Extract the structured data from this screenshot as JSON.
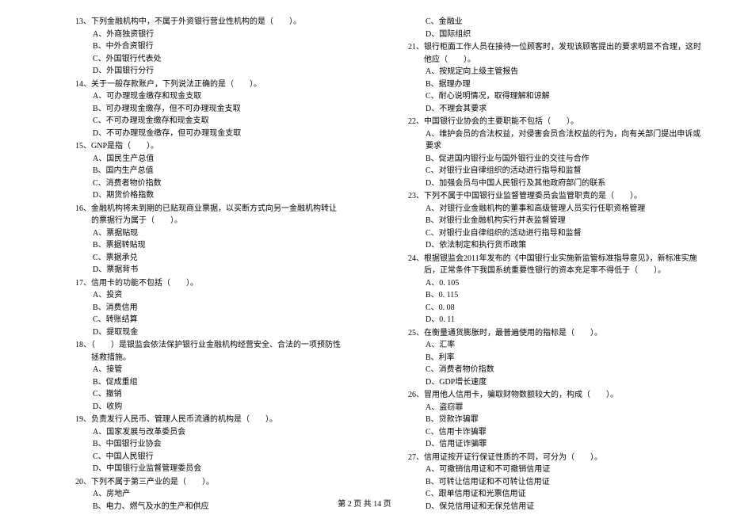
{
  "footer": "第 2 页  共 14 页",
  "left": {
    "q13": {
      "title": "13、下列金融机构中，不属于外资银行营业性机构的是（　　）。",
      "a": "A、外商独资银行",
      "b": "B、中外合资银行",
      "c": "C、外国银行代表处",
      "d": "D、外国银行分行"
    },
    "q14": {
      "title": "14、关于一般存款账户，下列说法正确的是（　　）。",
      "a": "A、可办理现金缴存和现金支取",
      "b": "B、可办理现金缴存，但不可办理现金支取",
      "c": "C、不可办理现金缴存和现金支取",
      "d": "D、不可办理现金缴存，但可办理现金支取"
    },
    "q15": {
      "title": "15、GNP是指（　　）。",
      "a": "A、国民生产总值",
      "b": "B、国内生产总值",
      "c": "C、消费者物价指数",
      "d": "D、期货价格指数"
    },
    "q16": {
      "title": "16、金融机构将未到期的已贴现商业票据，以买断方式向另一金融机构转让的票据行为属于（　　）。",
      "a": "A、票据贴现",
      "b": "B、票据转贴现",
      "c": "C、票据承兑",
      "d": "D、票据背书"
    },
    "q17": {
      "title": "17、信用卡的功能不包括（　　）。",
      "a": "A、投资",
      "b": "B、消费信用",
      "c": "C、转账结算",
      "d": "D、提取现金"
    },
    "q18": {
      "title": "18、（　　）是银监会依法保护银行业金融机构经营安全、合法的一项预防性拯救措施。",
      "a": "A、接管",
      "b": "B、促成重组",
      "c": "C、撤销",
      "d": "D、收购"
    },
    "q19": {
      "title": "19、负责发行人民币、管理人民币流通的机构是（　　）。",
      "a": "A、国家发展与改革委员会",
      "b": "B、中国银行业协会",
      "c": "C、中国人民银行",
      "d": "D、中国银行业监督管理委员会"
    },
    "q20": {
      "title": "20、下列不属于第三产业的是（　　）。",
      "a": "A、房地产",
      "b": "B、电力、燃气及水的生产和供应"
    }
  },
  "right": {
    "q20x": {
      "c": "C、金融业",
      "d": "D、国际组织"
    },
    "q21": {
      "title": "21、银行柜面工作人员在接待一位顾客时，发现该顾客提出的要求明显不合理，这时他应（　　）。",
      "a": "A、按规定向上级主管报告",
      "b": "B、据理办理",
      "c": "C、耐心说明情况，取得理解和谅解",
      "d": "D、不理会其要求"
    },
    "q22": {
      "title": "22、中国银行业协会的主要职能不包括（　　）。",
      "a": "A、维护会员的合法权益，对侵害会员合法权益的行为，向有关部门提出申诉或要求",
      "b": "B、促进国内银行业与国外银行业的交往与合作",
      "c": "C、对银行业自律组织的活动进行指导和监督",
      "d": "D、加强会员与中国人民银行及其他政府部门的联系"
    },
    "q23": {
      "title": "23、下列不属于中国银行业监督管理委员会监管职责的是（　　）。",
      "a": "A、对银行业金融机构的董事和高级管理人员实行任职资格管理",
      "b": "B、对银行业金融机构实行并表监督管理",
      "c": "C、对银行业自律组织的活动进行指导和监督",
      "d": "D、依法制定和执行货币政策"
    },
    "q24": {
      "title": "24、根据银监会2011年发布的《中国银行业实施新监管标准指导意见》，新标准实施后，正常条件下我国系统重要性银行的资本充足率不得低于（　　）。",
      "a": "A、0. 105",
      "b": "B、0. 115",
      "c": "C、0. 08",
      "d": "D、0. 11"
    },
    "q25": {
      "title": "25、在衡量通货膨胀时，最普遍使用的指标是（　　）。",
      "a": "A、汇率",
      "b": "B、利率",
      "c": "C、消费者物价指数",
      "d": "D、GDP增长速度"
    },
    "q26": {
      "title": "26、冒用他人信用卡，骗取财物数额较大的，构成（　　）。",
      "a": "A、盗窃罪",
      "b": "B、贷款诈骗罪",
      "c": "C、信用卡诈骗罪",
      "d": "D、信用证诈骗罪"
    },
    "q27": {
      "title": "27、信用证按开证行保证性质的不同，可分为（　　）。",
      "a": "A、可撤销信用证和不可撤销信用证",
      "b": "B、可转让信用证和不可转让信用证",
      "c": "C、跟单信用证和光票信用证",
      "d": "D、保兑信用证和无保兑信用证"
    }
  }
}
